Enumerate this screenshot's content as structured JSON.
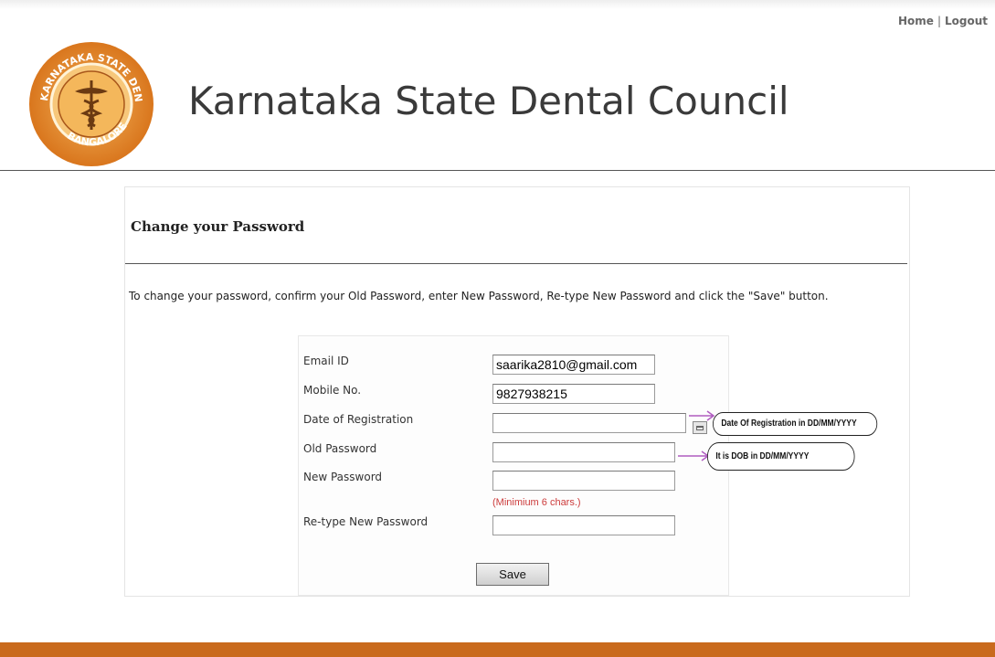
{
  "header": {
    "home_link": "Home",
    "separator": "|",
    "logout_link": "Logout",
    "site_title": "Karnataka State Dental Council",
    "logo_text": {
      "top_arc": "KARNATAKA STATE DENTAL COUNCIL",
      "bottom_arc": "BANGALORE"
    }
  },
  "panel": {
    "title": "Change your Password",
    "instructions": "To change your password, confirm your Old Password, enter New Password, Re-type New Password and click the \"Save\" button."
  },
  "form": {
    "email_label": "Email ID",
    "email_value": "saarika2810@gmail.com",
    "mobile_label": "Mobile No.",
    "mobile_value": "9827938215",
    "registration_label": "Date of Registration",
    "registration_value": "",
    "old_password_label": "Old Password",
    "old_password_value": "",
    "new_password_label": "New Password",
    "new_password_value": "",
    "new_password_hint": "(Minimium 6 chars.)",
    "retype_label": "Re-type New Password",
    "retype_value": "",
    "save_label": "Save"
  },
  "callouts": {
    "registration_hint": "Date Of Registration in DD/MM/YYYY",
    "dob_hint": "It is DOB in DD/MM/YYYY"
  },
  "colors": {
    "brand_orange": "#c96a1d",
    "hint_red": "#cc3b3b",
    "arrow_purple": "#b05cc0"
  },
  "icons": {
    "calendar": "calendar-icon",
    "logo": "council-seal-logo"
  }
}
